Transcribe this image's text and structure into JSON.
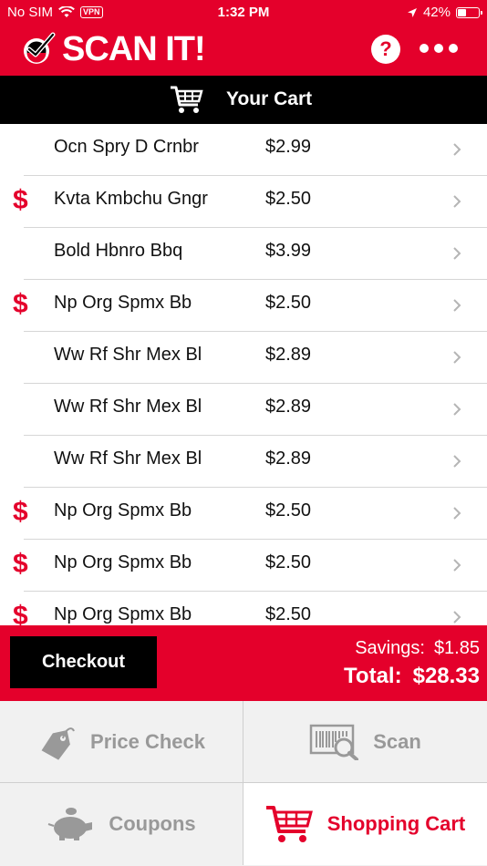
{
  "status_bar": {
    "carrier": "No SIM",
    "vpn": "VPN",
    "time": "1:32 PM",
    "battery": "42%",
    "battery_level": 0.42
  },
  "header": {
    "title": "SCAN IT!",
    "help_label": "?"
  },
  "cart_header": {
    "title": "Your Cart"
  },
  "cart_items": [
    {
      "name": "Ocn Spry D Crnbr",
      "price": "$2.99",
      "savings": false
    },
    {
      "name": "Kvta Kmbchu Gngr",
      "price": "$2.50",
      "savings": true
    },
    {
      "name": "Bold Hbnro Bbq",
      "price": "$3.99",
      "savings": false
    },
    {
      "name": "Np Org Spmx Bb",
      "price": "$2.50",
      "savings": true
    },
    {
      "name": "Ww Rf Shr Mex Bl",
      "price": "$2.89",
      "savings": false
    },
    {
      "name": "Ww Rf Shr Mex Bl",
      "price": "$2.89",
      "savings": false
    },
    {
      "name": "Ww Rf Shr Mex Bl",
      "price": "$2.89",
      "savings": false
    },
    {
      "name": "Np Org Spmx Bb",
      "price": "$2.50",
      "savings": true
    },
    {
      "name": "Np Org Spmx Bb",
      "price": "$2.50",
      "savings": true
    },
    {
      "name": "Np Org Spmx Bb",
      "price": "$2.50",
      "savings": true
    }
  ],
  "savings_symbol": "$",
  "summary": {
    "checkout_label": "Checkout",
    "savings_label": "Savings:",
    "savings_amount": "$1.85",
    "total_label": "Total:",
    "total_amount": "$28.33"
  },
  "tabs": {
    "price_check": "Price Check",
    "scan": "Scan",
    "coupons": "Coupons",
    "shopping_cart": "Shopping Cart",
    "active": "shopping_cart"
  },
  "colors": {
    "brand_red": "#e4002b",
    "black": "#000000",
    "inactive_gray": "#999999"
  }
}
